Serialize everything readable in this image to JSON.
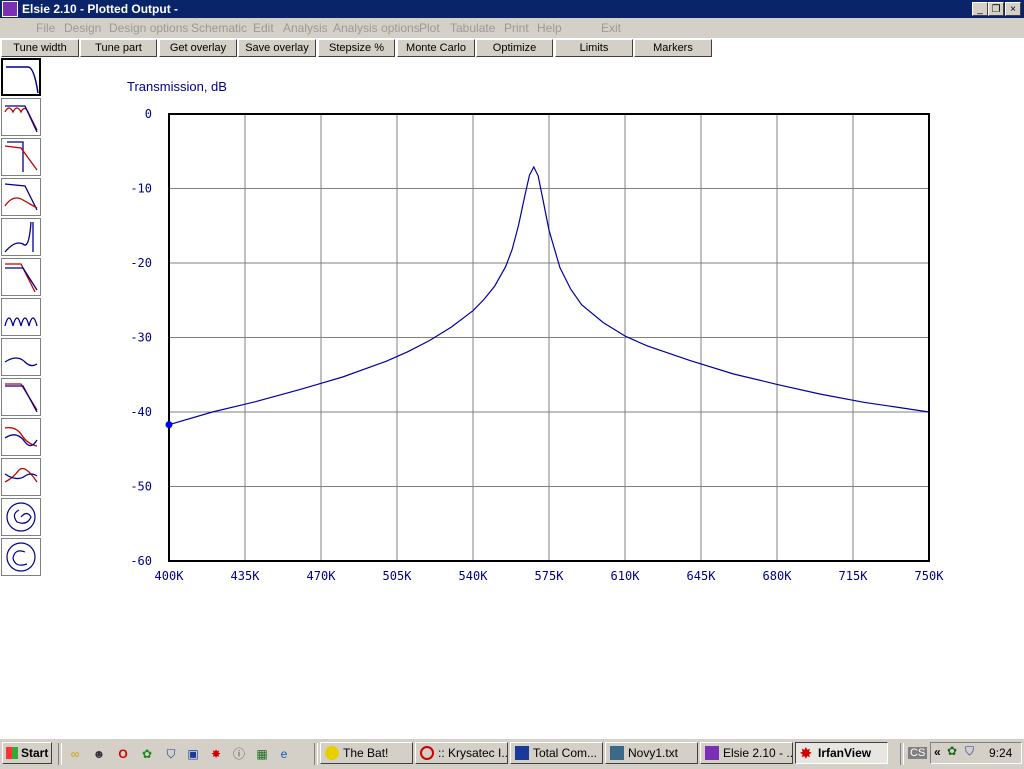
{
  "window": {
    "title": "Elsie 2.10 - Plotted Output -",
    "controls": [
      "_",
      "❐",
      "×"
    ]
  },
  "menu": [
    "File",
    "Design",
    "Design options",
    "Schematic",
    "Edit",
    "Analysis",
    "Analysis options",
    "Plot",
    "Tabulate",
    "Print",
    "Help",
    "Exit"
  ],
  "toolbar": [
    "Tune width",
    "Tune part",
    "Get overlay",
    "Save overlay",
    "Stepsize %",
    "Monte Carlo",
    "Optimize",
    "Limits",
    "Markers"
  ],
  "palette": [
    {
      "name": "lowpass-plot-icon",
      "selected": true
    },
    {
      "name": "ripple-lowpass-plot-icon"
    },
    {
      "name": "lowpass-phase-plot-icon"
    },
    {
      "name": "lowpass-group-delay-icon"
    },
    {
      "name": "highpass-plot-icon"
    },
    {
      "name": "lowpass-overlay-icon"
    },
    {
      "name": "notch-plot-icon"
    },
    {
      "name": "lowpass-dual-icon"
    },
    {
      "name": "transient-plot-icon"
    },
    {
      "name": "crossover-plot-icon"
    },
    {
      "name": "smith-chart-icon"
    },
    {
      "name": "polar-chart-icon"
    }
  ],
  "chart_data": {
    "type": "line",
    "ylabel": "Transmission, dB",
    "xlim": [
      400000,
      750000
    ],
    "ylim": [
      -60,
      0
    ],
    "x_ticks": [
      400000,
      435000,
      470000,
      505000,
      540000,
      575000,
      610000,
      645000,
      680000,
      715000,
      750000
    ],
    "x_tick_labels": [
      "400K",
      "435K",
      "470K",
      "505K",
      "540K",
      "575K",
      "610K",
      "645K",
      "680K",
      "715K",
      "750K"
    ],
    "y_ticks": [
      0,
      -10,
      -20,
      -30,
      -40,
      -50,
      -60
    ],
    "y_tick_labels": [
      "0",
      "-10",
      "-20",
      "-30",
      "-40",
      "-50",
      "-60"
    ],
    "grid": true,
    "series": [
      {
        "color": "#0000a0",
        "x": [
          400000,
          420000,
          440000,
          460000,
          480000,
          500000,
          510000,
          520000,
          530000,
          540000,
          545000,
          550000,
          555000,
          558000,
          561000,
          564000,
          566000,
          568000,
          570000,
          572000,
          575000,
          580000,
          585000,
          590000,
          600000,
          610000,
          620000,
          640000,
          660000,
          680000,
          700000,
          720000,
          750000
        ],
        "y": [
          -41.7,
          -40.0,
          -38.6,
          -37.0,
          -35.3,
          -33.2,
          -31.9,
          -30.4,
          -28.6,
          -26.4,
          -24.9,
          -23.1,
          -20.5,
          -18.2,
          -14.9,
          -10.8,
          -8.2,
          -7.1,
          -8.3,
          -11.2,
          -15.6,
          -20.6,
          -23.5,
          -25.6,
          -28.0,
          -29.8,
          -31.1,
          -33.1,
          -34.9,
          -36.3,
          -37.6,
          -38.7,
          -40.0
        ]
      }
    ],
    "marker": {
      "x": 400000,
      "y": -41.7
    }
  },
  "taskbar": {
    "start_label": "Start",
    "quick_launch": [
      "winamp-icon",
      "smiley-icon",
      "opera-icon",
      "frog-icon",
      "shield-icon",
      "floppy-icon",
      "splat-icon",
      "info-icon",
      "calculator-icon",
      "ie-icon"
    ],
    "tasks": [
      {
        "label": "The Bat!",
        "icon": "bat-icon",
        "color": "#e8d000"
      },
      {
        "label": ":: Krysatec I...",
        "icon": "opera-icon",
        "color": "#d00000"
      },
      {
        "label": "Total Com...",
        "icon": "floppy-icon",
        "color": "#1a3a9a"
      },
      {
        "label": "Novy1.txt",
        "icon": "notepad-icon",
        "color": "#3a6a8a"
      },
      {
        "label": "Elsie 2.10 - ...",
        "icon": "elsie-icon",
        "color": "#7a2fb5"
      },
      {
        "label": "IrfanView",
        "icon": "irfanview-icon",
        "color": "#d00000",
        "active": true
      }
    ],
    "tray_lang": "CS",
    "tray_expand": "«",
    "clock": "9:24"
  }
}
